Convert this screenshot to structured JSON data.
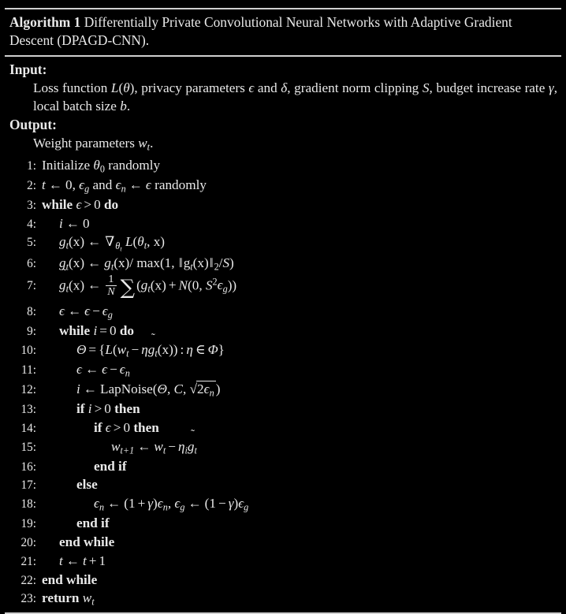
{
  "document": {
    "type": "algorithm-pseudocode",
    "colors": {
      "background": "#000000",
      "text": "#e9e9e9",
      "rule": "#cfcfcf"
    }
  },
  "caption": {
    "label": "Algorithm 1",
    "title": "Differentially Private Convolutional Neural Networks with Adaptive Gradient Descent (DPAGD-CNN)."
  },
  "input": {
    "heading": "Input:",
    "text": "Loss function L(θ), privacy parameters ϵ and δ, gradient norm clipping S, budget increase rate γ, local batch size b."
  },
  "output": {
    "heading": "Output:",
    "text": "Weight parameters w_t."
  },
  "lines": [
    {
      "n": "1:",
      "indent": 0,
      "text": "Initialize θ₀ randomly"
    },
    {
      "n": "2:",
      "indent": 0,
      "text": "t ← 0, ϵ_g and ϵ_n ← ϵ randomly"
    },
    {
      "n": "3:",
      "indent": 0,
      "text": "while ϵ > 0 do"
    },
    {
      "n": "4:",
      "indent": 1,
      "text": "i ← 0"
    },
    {
      "n": "5:",
      "indent": 1,
      "text": "g_t(x) ← ∇_{θ_t} L(θ_t, x)"
    },
    {
      "n": "6:",
      "indent": 1,
      "text": "g_t(x) ← g_t(x)/ max(1, ‖g_t(x)‖₂/S)"
    },
    {
      "n": "7:",
      "indent": 1,
      "text": "g̃_t(x) ← (1/N) Σ(g_t(x) + N(0, S²ϵ_g))"
    },
    {
      "n": "8:",
      "indent": 1,
      "text": "ϵ ← ϵ − ϵ_g"
    },
    {
      "n": "9:",
      "indent": 1,
      "text": "while i = 0 do"
    },
    {
      "n": "10:",
      "indent": 2,
      "text": "Θ = {L(w_t − η g̃_t(x)) : η ∈ Φ}"
    },
    {
      "n": "11:",
      "indent": 2,
      "text": "ϵ ← ϵ − ϵ_n"
    },
    {
      "n": "12:",
      "indent": 2,
      "text": "i ← LapNoise(Θ, C, √(2ϵ_n))"
    },
    {
      "n": "13:",
      "indent": 2,
      "text": "if i > 0 then"
    },
    {
      "n": "14:",
      "indent": 3,
      "text": "if ϵ > 0 then"
    },
    {
      "n": "15:",
      "indent": 4,
      "text": "w_{t+1} ← w_t − η_i g̃_t"
    },
    {
      "n": "16:",
      "indent": 3,
      "text": "end if"
    },
    {
      "n": "17:",
      "indent": 2,
      "text": "else"
    },
    {
      "n": "18:",
      "indent": 3,
      "text": "ϵ_n ← (1 + γ)ϵ_n, ϵ_g ← (1 − γ)ϵ_g"
    },
    {
      "n": "19:",
      "indent": 2,
      "text": "end if"
    },
    {
      "n": "20:",
      "indent": 1,
      "text": "end while"
    },
    {
      "n": "21:",
      "indent": 1,
      "text": "t ← t + 1"
    },
    {
      "n": "22:",
      "indent": 0,
      "text": "end while"
    },
    {
      "n": "23:",
      "indent": 0,
      "text": "return w_t"
    }
  ]
}
